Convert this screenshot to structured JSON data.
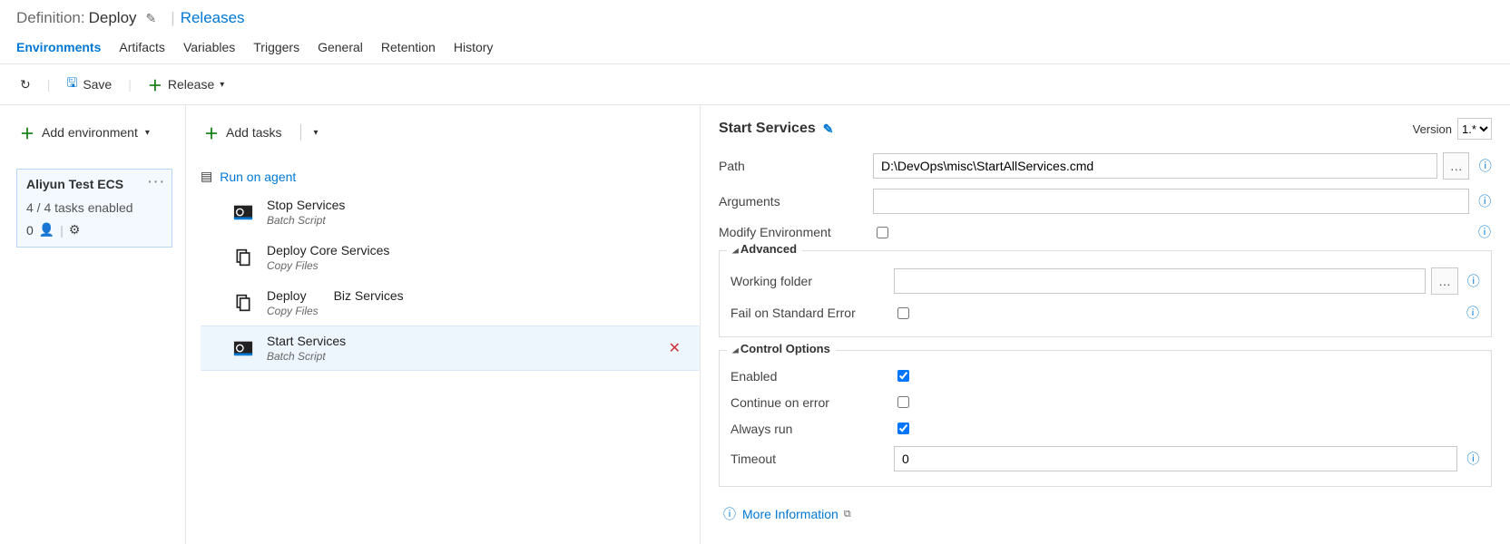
{
  "header": {
    "definition_label": "Definition:",
    "definition_name": "Deploy",
    "releases_link": "Releases"
  },
  "tabs": [
    "Environments",
    "Artifacts",
    "Variables",
    "Triggers",
    "General",
    "Retention",
    "History"
  ],
  "active_tab": 0,
  "toolbar": {
    "save": "Save",
    "release": "Release"
  },
  "sidebar": {
    "add_environment": "Add environment",
    "env": {
      "title": "Aliyun Test ECS",
      "status": "4 / 4 tasks enabled",
      "users": "0"
    }
  },
  "tasks": {
    "add_tasks": "Add tasks",
    "run_on_agent": "Run on agent",
    "list": [
      {
        "name": "Stop Services",
        "sub": "Batch Script",
        "icon": "gear"
      },
      {
        "name": "Deploy Core Services",
        "sub": "Copy Files",
        "icon": "copy"
      },
      {
        "name": "Deploy",
        "name2": "Biz Services",
        "sub": "Copy Files",
        "icon": "copy"
      },
      {
        "name": "Start Services",
        "sub": "Batch Script",
        "icon": "gear"
      }
    ],
    "selected": 3
  },
  "detail": {
    "title": "Start Services",
    "version_label": "Version",
    "version_value": "1.*",
    "fields": {
      "path_label": "Path",
      "path_value": "D:\\DevOps\\misc\\StartAllServices.cmd",
      "arguments_label": "Arguments",
      "arguments_value": "",
      "modify_env_label": "Modify Environment",
      "modify_env_checked": false
    },
    "advanced": {
      "legend": "Advanced",
      "working_folder_label": "Working folder",
      "working_folder_value": "",
      "fail_label": "Fail on Standard Error",
      "fail_checked": false
    },
    "control": {
      "legend": "Control Options",
      "enabled_label": "Enabled",
      "enabled_checked": true,
      "continue_label": "Continue on error",
      "continue_checked": false,
      "always_label": "Always run",
      "always_checked": true,
      "timeout_label": "Timeout",
      "timeout_value": "0"
    },
    "more_info": "More Information"
  }
}
